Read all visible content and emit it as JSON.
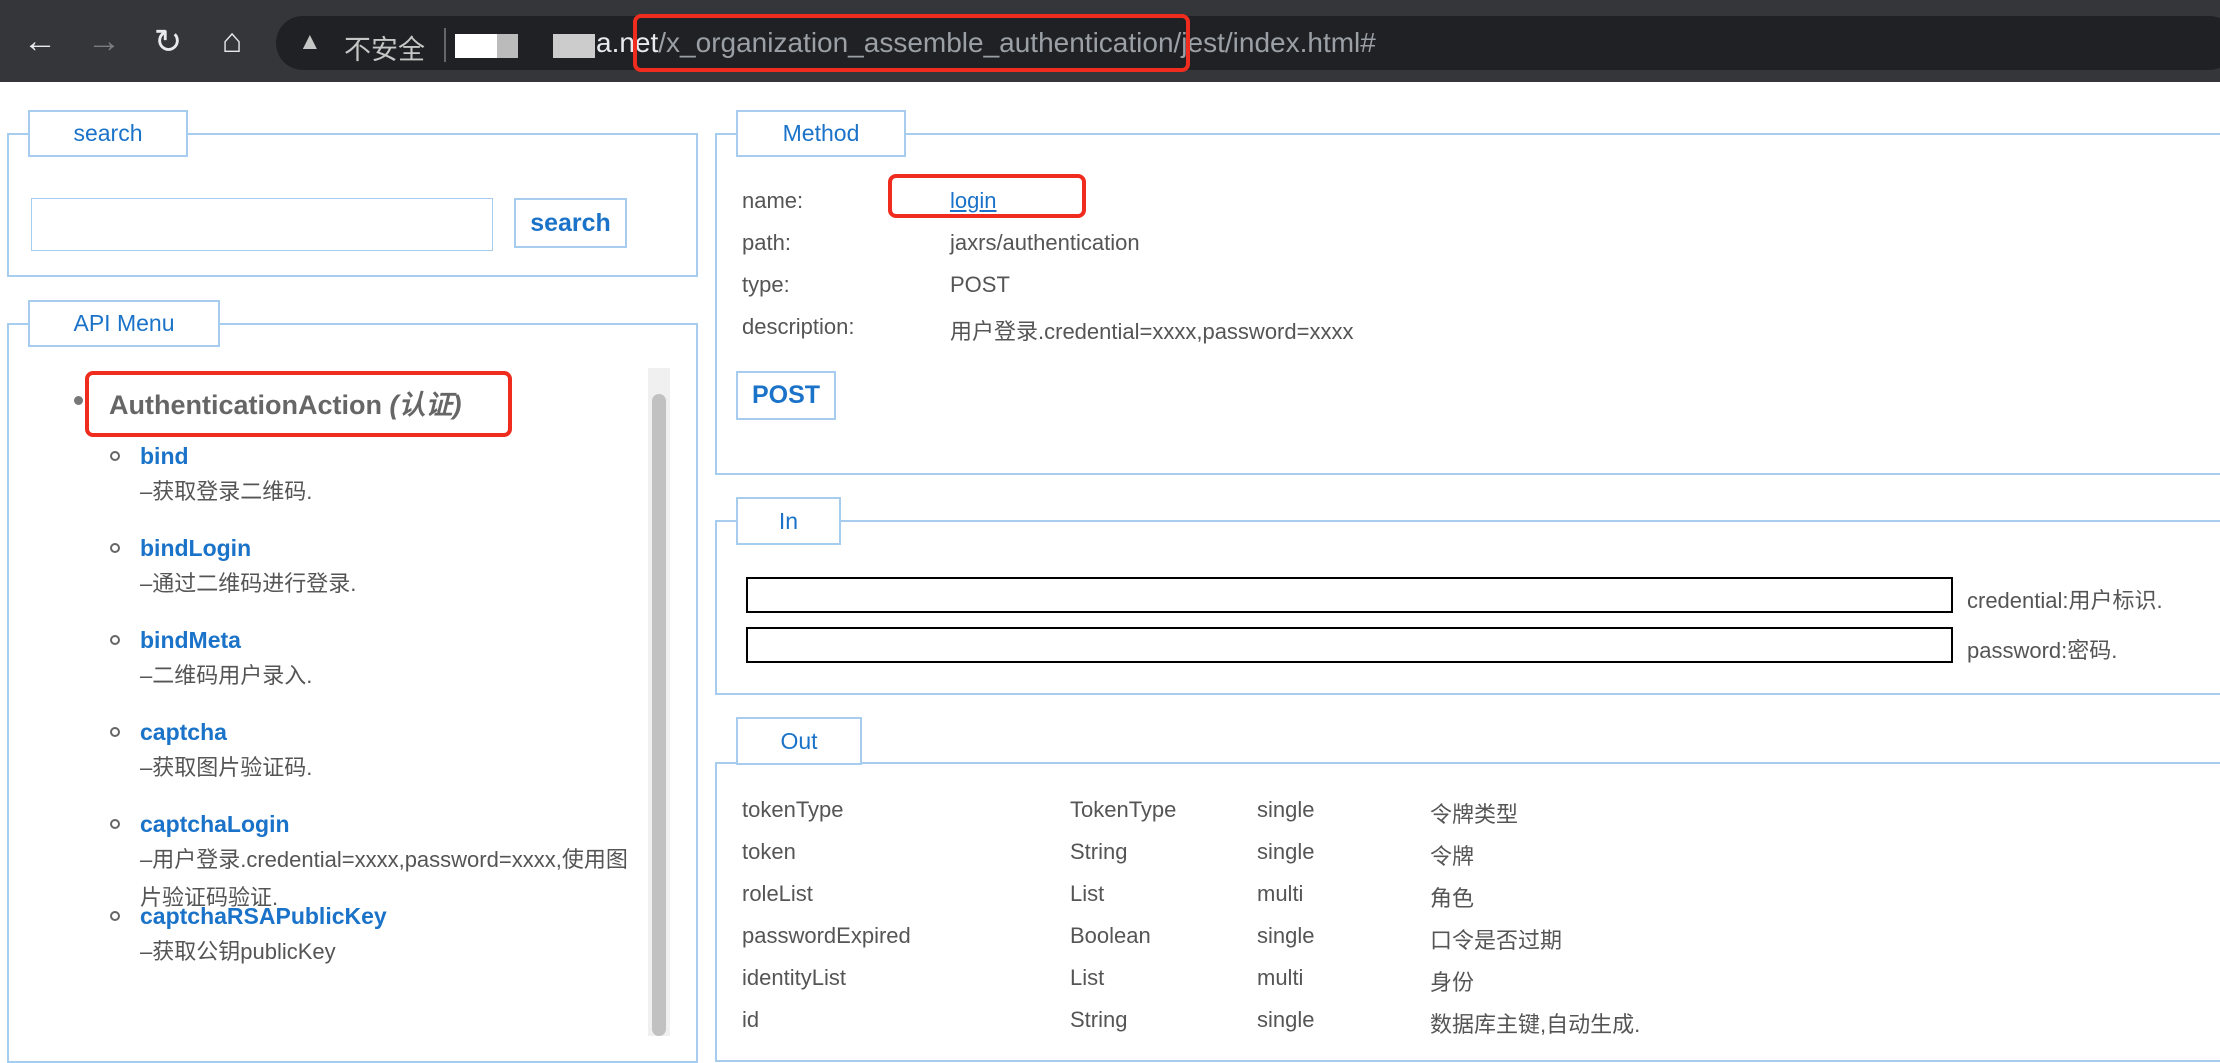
{
  "browser": {
    "back": "←",
    "forward": "→",
    "reload": "↻",
    "home": "⌂",
    "security_warning": "▲",
    "security_label": "不安全",
    "url_host": "a.net",
    "url_path_highlight": "/x_organization_assemble_authentication",
    "url_rest": "/jest/index.html#"
  },
  "search": {
    "legend": "search",
    "input_value": "",
    "button": "search"
  },
  "api_menu": {
    "legend": "API Menu",
    "group": "AuthenticationAction",
    "group_cn": " (认证)",
    "items": [
      {
        "name": "bind",
        "desc": "–获取登录二维码."
      },
      {
        "name": "bindLogin",
        "desc": "–通过二维码进行登录."
      },
      {
        "name": "bindMeta",
        "desc": "–二维码用户录入."
      },
      {
        "name": "captcha",
        "desc": "–获取图片验证码."
      },
      {
        "name": "captchaLogin",
        "desc": "–用户登录.credential=xxxx,password=xxxx,使用图片验证码验证."
      },
      {
        "name": "captchaRSAPublicKey",
        "desc": "–获取公钥publicKey"
      }
    ]
  },
  "method": {
    "legend": "Method",
    "name_label": "name:",
    "name": "login",
    "path_label": "path:",
    "path": "jaxrs/authentication",
    "type_label": "type:",
    "type": "POST",
    "desc_label": "description:",
    "desc": "用户登录.credential=xxxx,password=xxxx",
    "button": "POST"
  },
  "in": {
    "legend": "In",
    "params": [
      {
        "value": "",
        "label": "credential:用户标识."
      },
      {
        "value": "",
        "label": "password:密码."
      }
    ]
  },
  "out": {
    "legend": "Out",
    "rows": [
      [
        "tokenType",
        "TokenType",
        "single",
        "令牌类型"
      ],
      [
        "token",
        "String",
        "single",
        "令牌"
      ],
      [
        "roleList",
        "List",
        "multi",
        "角色"
      ],
      [
        "passwordExpired",
        "Boolean",
        "single",
        "口令是否过期"
      ],
      [
        "identityList",
        "List",
        "multi",
        "身份"
      ],
      [
        "id",
        "String",
        "single",
        "数据库主键,自动生成."
      ]
    ]
  }
}
